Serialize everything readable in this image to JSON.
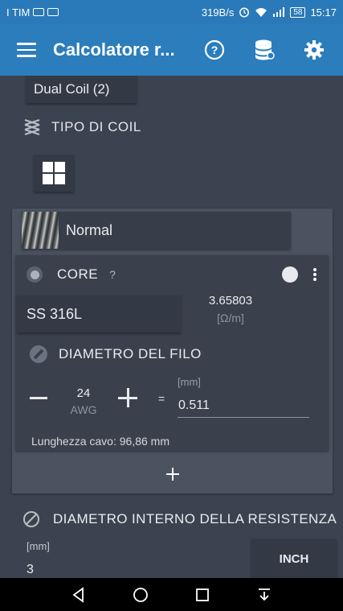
{
  "status_bar": {
    "carrier": "I TIM",
    "net_speed": "319B/s",
    "battery": "58",
    "time": "15:17"
  },
  "app_bar": {
    "title": "Calcolatore r...",
    "menu_icon": "hamburger-menu-icon",
    "actions": [
      {
        "name": "help-icon"
      },
      {
        "name": "database-icon"
      },
      {
        "name": "gear-icon"
      }
    ]
  },
  "coil_count": {
    "label": "Dual Coil (2)"
  },
  "coil_type": {
    "heading": "TIPO DI COIL",
    "icon": "coil-type-icon",
    "grid_icon": "grid-icon"
  },
  "coil_style": {
    "label": "Normal"
  },
  "core": {
    "label": "CORE",
    "help": "?",
    "material": "SS 316L",
    "resistivity": "3.65803",
    "resistivity_unit": "[Ω/m]"
  },
  "wire_diameter": {
    "heading": "DIAMETRO DEL FILO",
    "gauge_value": "24",
    "gauge_unit": "AWG",
    "equals": "=",
    "mm_label": "[mm]",
    "mm_value": "0.511"
  },
  "cable_length": "Lunghezza cavo: 96,86 mm",
  "inner_diameter": {
    "heading": "DIAMETRO INTERNO DELLA RESISTENZA",
    "unit_label": "[mm]",
    "value": "3",
    "unit_button": "INCH"
  },
  "colors": {
    "appbar": "#2b7dbc",
    "statusbar": "#2a79b8",
    "background": "#3c4350",
    "panel": "#4b5260",
    "card": "#3b414c"
  }
}
